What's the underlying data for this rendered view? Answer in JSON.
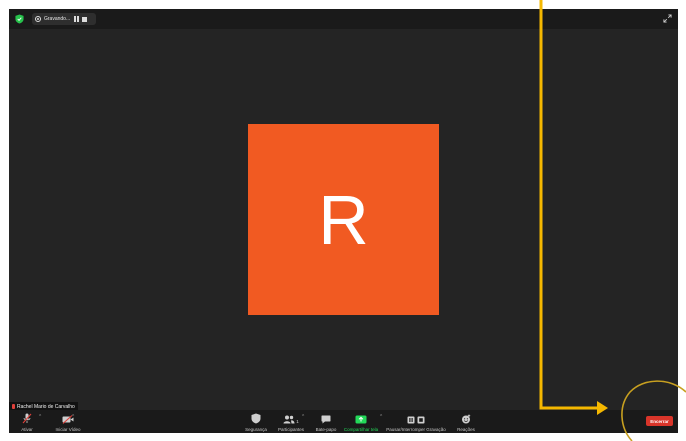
{
  "top_bar": {
    "recording_label": "Gravando...",
    "icons": [
      "shield-icon",
      "pause-icon",
      "stop-icon",
      "fullscreen-icon"
    ]
  },
  "participant": {
    "initial": "R",
    "name": "Rachel Mario de Carvalho",
    "avatar_color": "#f15a22"
  },
  "toolbar": {
    "mute_label": "Ativar",
    "video_label": "Iniciar Vídeo",
    "security_label": "Segurança",
    "participants_label": "Participantes",
    "participants_count": "1",
    "chat_label": "Bate-papo",
    "share_label": "Compartilhar tela",
    "record_label": "Pausar/Interromper Gravação",
    "reactions_label": "Reações",
    "end_label": "Encerrar"
  },
  "colors": {
    "window_bg": "#242424",
    "toolbar_bg": "#1a1a1a",
    "share_green": "#23d959",
    "end_red": "#d9352a",
    "annotation_yellow": "#f5b800"
  }
}
